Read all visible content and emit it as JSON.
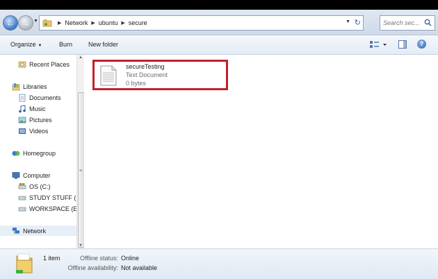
{
  "address_bar": {
    "crumbs": [
      "Network",
      "ubuntu",
      "secure"
    ],
    "search_placeholder": "Search sec..."
  },
  "command_bar": {
    "organize": "Organize",
    "burn": "Burn",
    "new_folder": "New folder"
  },
  "nav_pane": {
    "items": [
      {
        "label": "Recent Places",
        "icon": "recent-places-icon"
      },
      {
        "label": "Libraries",
        "icon": "libraries-icon"
      },
      {
        "label": "Documents",
        "icon": "documents-icon"
      },
      {
        "label": "Music",
        "icon": "music-icon"
      },
      {
        "label": "Pictures",
        "icon": "pictures-icon"
      },
      {
        "label": "Videos",
        "icon": "videos-icon"
      },
      {
        "label": "Homegroup",
        "icon": "homegroup-icon"
      },
      {
        "label": "Computer",
        "icon": "computer-icon"
      },
      {
        "label": "OS (C:)",
        "icon": "drive-icon"
      },
      {
        "label": "STUDY STUFF (D:",
        "icon": "drive-icon"
      },
      {
        "label": "WORKSPACE (E:)",
        "icon": "drive-icon"
      },
      {
        "label": "Network",
        "icon": "network-icon"
      }
    ]
  },
  "file": {
    "name": "secureTesting",
    "type": "Text Document",
    "size": "0 bytes"
  },
  "details": {
    "count": "1 item",
    "offline_status_label": "Offline status:",
    "offline_status_value": "Online",
    "offline_availability_label": "Offline availability:",
    "offline_availability_value": "Not available"
  },
  "colors": {
    "highlight_box": "#c0202a",
    "selected_nav": "#e6eef8"
  }
}
